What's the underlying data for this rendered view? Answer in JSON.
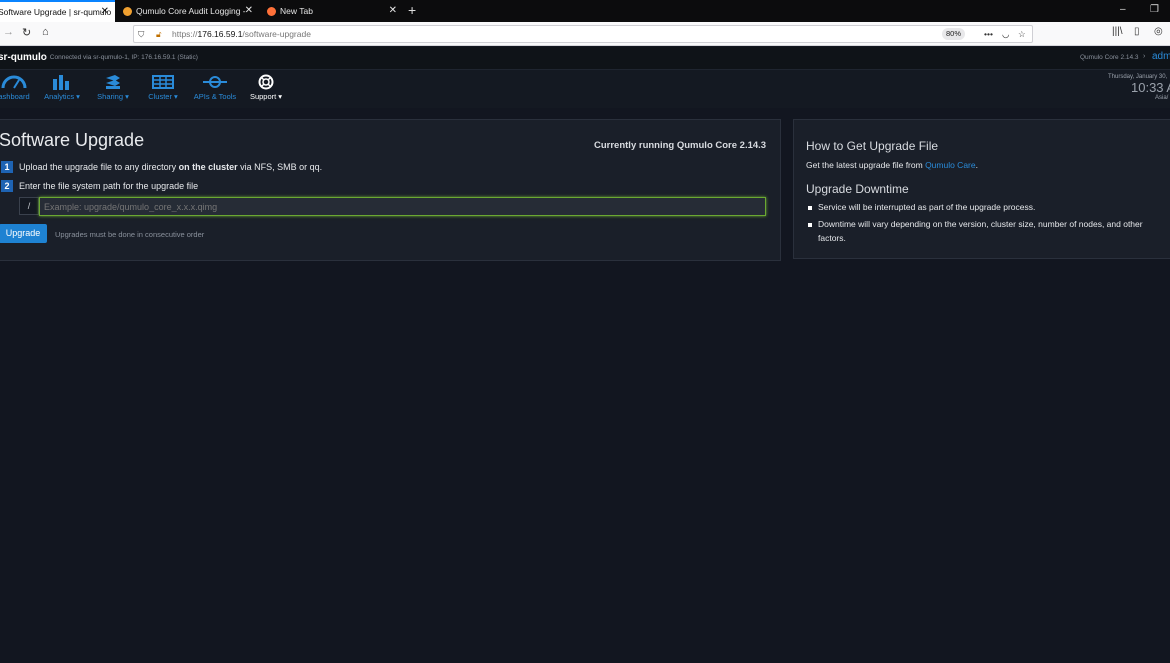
{
  "browser": {
    "tabs": [
      {
        "label": "Software Upgrade | sr-qumulo",
        "active": true
      },
      {
        "label": "Qumulo Core Audit Logging - ",
        "active": false
      },
      {
        "label": "New Tab",
        "active": false
      }
    ],
    "url_prefix": "https://",
    "url_host": "176.16.59.1",
    "url_path": "/software-upgrade",
    "zoom": "80%",
    "new_tab": "+"
  },
  "header": {
    "cluster_name": "sr-qumulo",
    "connection_info": "Connected via sr-qumulo-1, IP: 176.16.59.1 (Static)",
    "version": "Qumulo Core 2.14.3",
    "user": "adm"
  },
  "nav": {
    "items": [
      {
        "label": "ashboard",
        "icon": "gauge-icon"
      },
      {
        "label": "Analytics ▾",
        "icon": "bar-chart-icon"
      },
      {
        "label": "Sharing ▾",
        "icon": "share-icon"
      },
      {
        "label": "Cluster ▾",
        "icon": "server-icon"
      },
      {
        "label": "APIs & Tools",
        "icon": "api-icon"
      },
      {
        "label": "Support ▾",
        "icon": "lifebuoy-icon"
      }
    ],
    "date": "Thursday, January 30,",
    "time": "10:33 A",
    "timezone": "Asia/"
  },
  "upgrade": {
    "title": "Software Upgrade",
    "running": "Currently running Qumulo Core 2.14.3",
    "step1_num": "1",
    "step1_pre": "Upload the upgrade file to any directory ",
    "step1_bold": "on the cluster",
    "step1_post": " via NFS, SMB or qq.",
    "step2_num": "2",
    "step2_text": "Enter the file system path for the upgrade file",
    "path_prefix": "/",
    "path_placeholder": "Example: upgrade/qumulo_core_x.x.x.qimg",
    "button": "Upgrade",
    "note": "Upgrades must be done in consecutive order"
  },
  "info": {
    "title1": "How to Get Upgrade File",
    "text1_pre": "Get the latest upgrade file from ",
    "text1_link": "Qumulo Care",
    "text1_post": ".",
    "title2": "Upgrade Downtime",
    "bullet1": "Service will be interrupted as part of the upgrade process.",
    "bullet2": "Downtime will vary depending on the version, cluster size, number of nodes, and other factors."
  },
  "colors": {
    "accent": "#1e82d2",
    "bg": "#121620",
    "panel": "#1a1f29",
    "input_border": "#6ba832"
  }
}
